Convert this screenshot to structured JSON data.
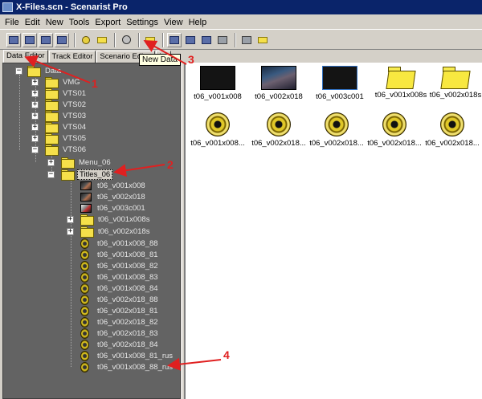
{
  "window": {
    "title": "X-Files.scn - Scenarist Pro"
  },
  "menu": [
    "File",
    "Edit",
    "New",
    "Tools",
    "Export",
    "Settings",
    "View",
    "Help"
  ],
  "tooltip": "New Data",
  "tabs": [
    "Data Editor",
    "Track Editor",
    "Scenario Editor",
    "La"
  ],
  "tree": {
    "root": "Data",
    "top": [
      "VMG",
      "VTS01",
      "VTS02",
      "VTS03",
      "VTS04",
      "VTS05",
      "VTS06"
    ],
    "vts06": [
      "Menu_06",
      "Titles_06"
    ],
    "titles_children": [
      "t06_v001x008",
      "t06_v002x018",
      "t06_v003c001",
      "t06_v001x008s",
      "t06_v002x018s",
      "t06_v001x008_88",
      "t06_v001x008_81",
      "t06_v001x008_82",
      "t06_v001x008_83",
      "t06_v001x008_84",
      "t06_v002x018_88",
      "t06_v002x018_81",
      "t06_v002x018_82",
      "t06_v002x018_83",
      "t06_v002x018_84",
      "t06_v001x008_81_rus",
      "t06_v001x008_88_rus"
    ]
  },
  "content_row1": [
    "t06_v001x008",
    "t06_v002x018",
    "t06_v003c001",
    "t06_v001x008s",
    "t06_v002x018s"
  ],
  "content_row2": [
    "t06_v001x008...",
    "t06_v002x018...",
    "t06_v002x018...",
    "t06_v002x018...",
    "t06_v002x018..."
  ],
  "annotations": [
    "1",
    "2",
    "3",
    "4"
  ],
  "colors": {
    "annotation": "#e02020",
    "tree_bg": "#636363",
    "title_bar": "#0a246a"
  }
}
